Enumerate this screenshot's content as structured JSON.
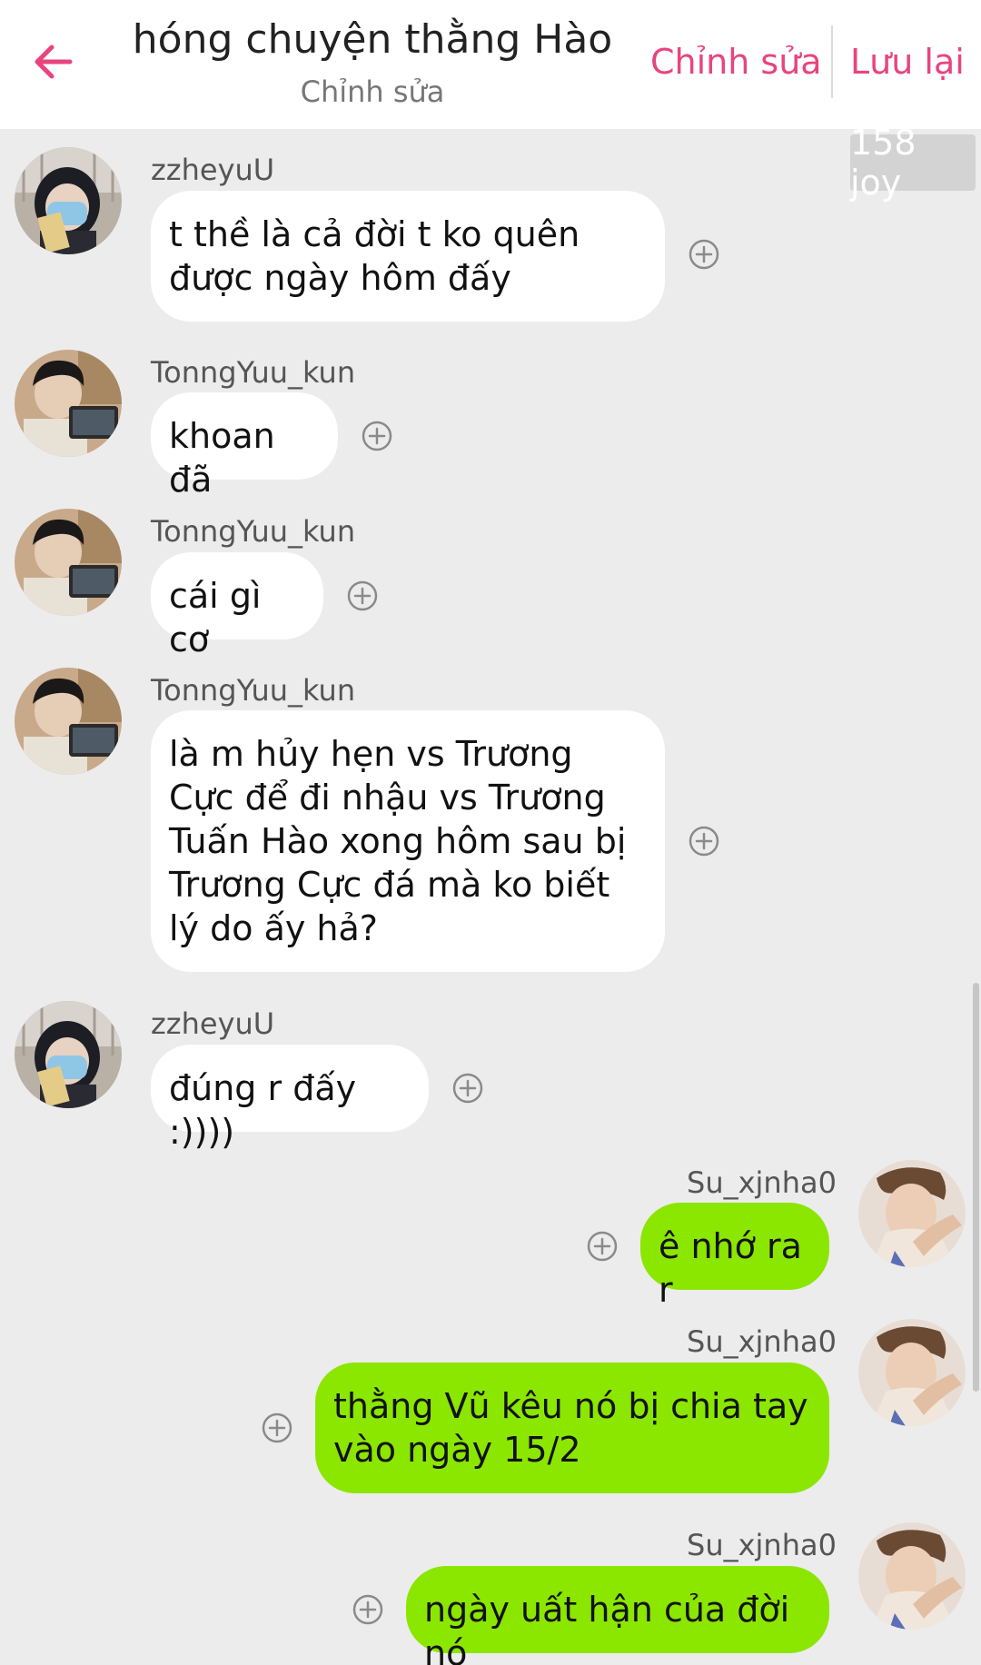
{
  "header": {
    "title": "hóng chuyện thằng Hào",
    "subtitle": "Chỉnh sửa",
    "edit_label": "Chỉnh sửa",
    "save_label": "Lưu lại"
  },
  "badge": {
    "text": "158 joy"
  },
  "messages": [
    {
      "sender": "zzheyuU",
      "text": "t thề là cả đời t ko quên được ngày hôm đấy"
    },
    {
      "sender": "TonngYuu_kun",
      "text": "khoan đã"
    },
    {
      "sender": "TonngYuu_kun",
      "text": "cái gì cơ"
    },
    {
      "sender": "TonngYuu_kun",
      "text": "là m hủy hẹn vs Trương Cực để đi nhậu vs Trương Tuấn Hào xong hôm sau bị Trương Cực đá mà ko biết lý do ấy hả?"
    },
    {
      "sender": "zzheyuU",
      "text": "đúng r đấy :))))"
    },
    {
      "sender": "Su_xjnha0",
      "text": "ê nhớ ra r"
    },
    {
      "sender": "Su_xjnha0",
      "text": "thằng Vũ kêu nó bị chia tay vào ngày 15/2"
    },
    {
      "sender": "Su_xjnha0",
      "text": "ngày uất hận của đời nó"
    }
  ],
  "colors": {
    "accent": "#e8447f",
    "own_bubble": "#8be600",
    "other_bubble": "#ffffff",
    "background": "#ececec"
  }
}
